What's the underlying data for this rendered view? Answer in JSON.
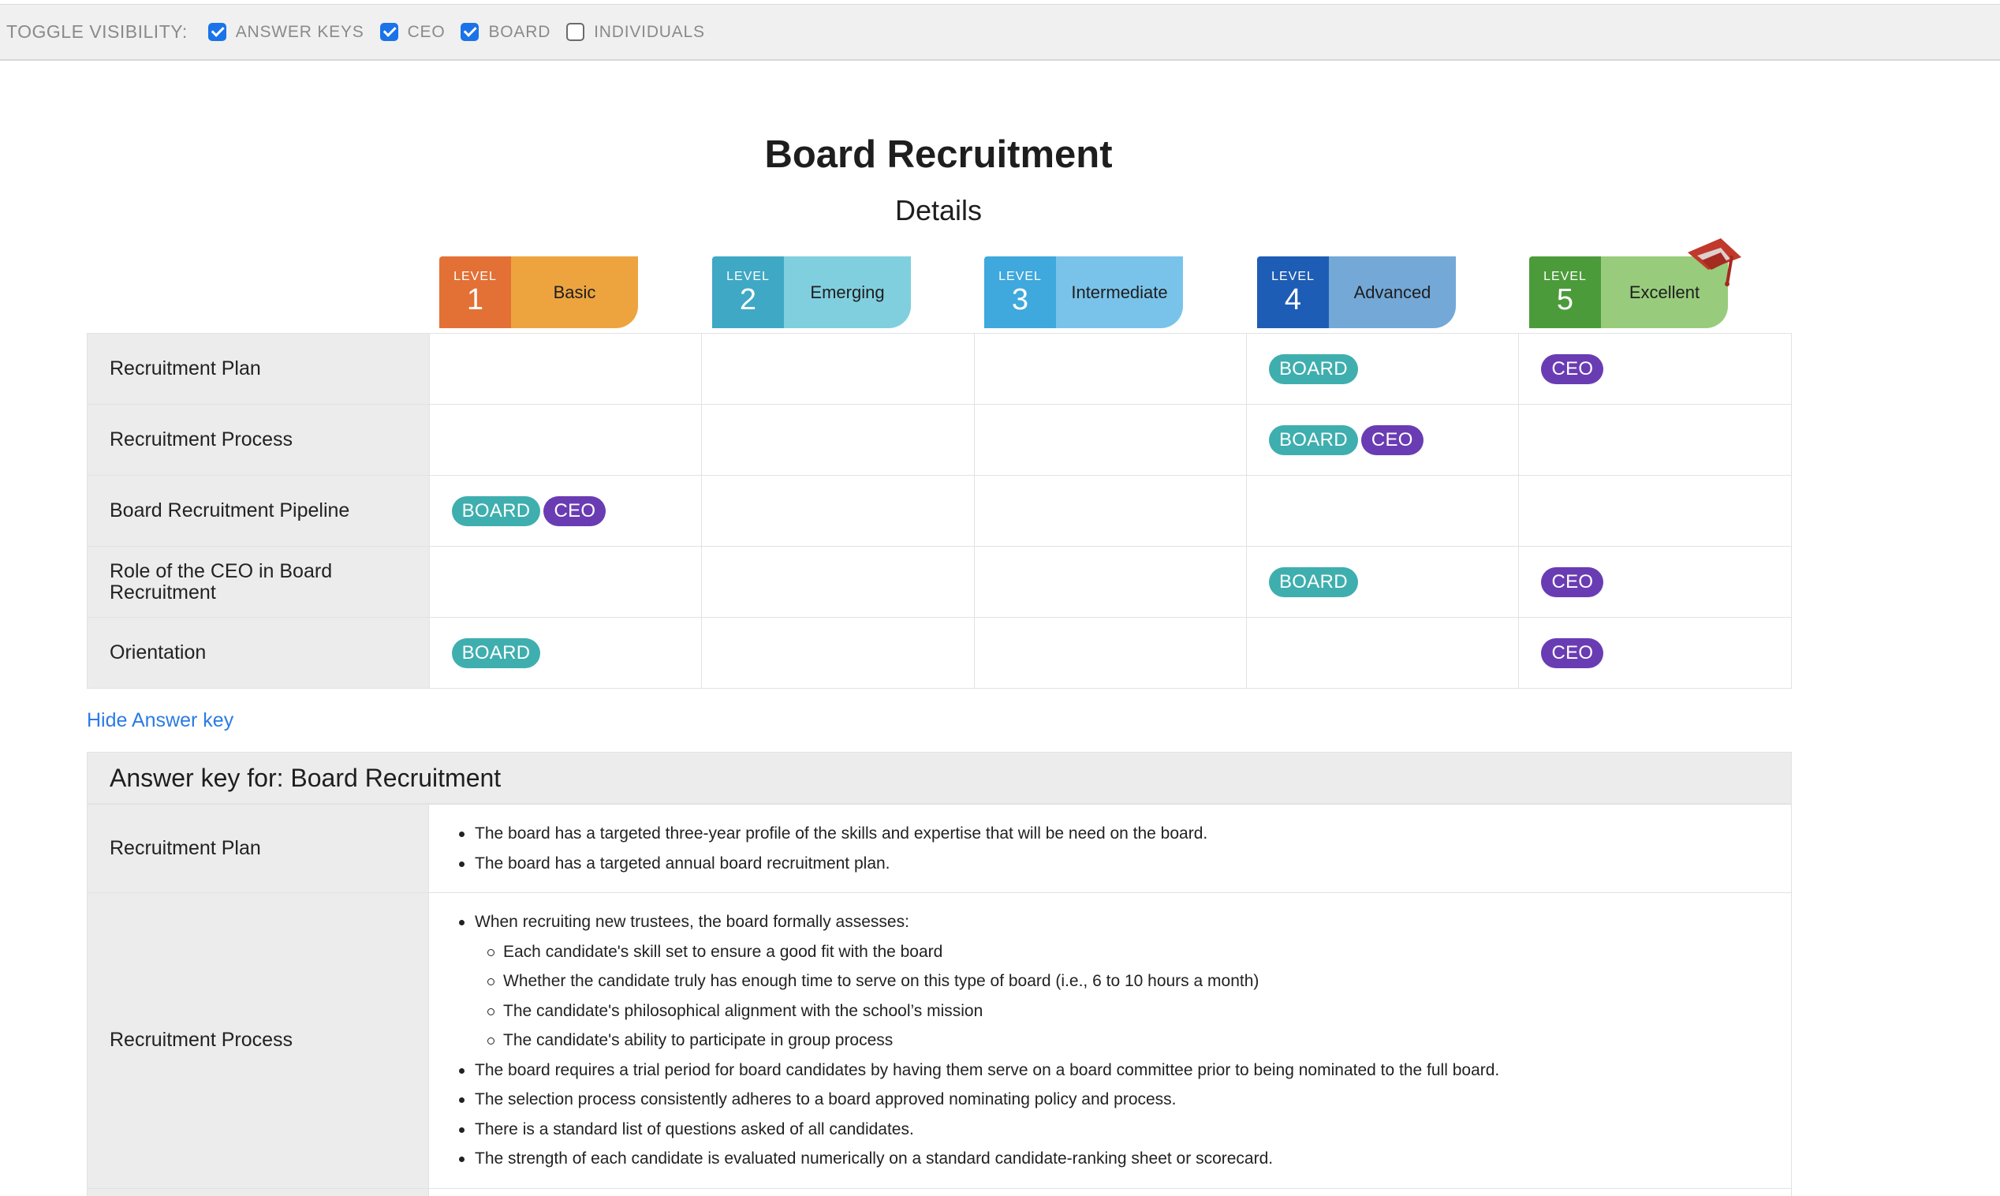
{
  "toggle_bar": {
    "label": "TOGGLE VISIBILITY:",
    "items": [
      {
        "label": "ANSWER KEYS",
        "checked": true
      },
      {
        "label": "CEO",
        "checked": true
      },
      {
        "label": "BOARD",
        "checked": true
      },
      {
        "label": "INDIVIDUALS",
        "checked": false
      }
    ]
  },
  "page": {
    "title": "Board Recruitment",
    "subtitle": "Details"
  },
  "levels": [
    {
      "prefix": "LEVEL",
      "number": "1",
      "name": "Basic",
      "num_color": "#e37034",
      "name_color": "#eda43f"
    },
    {
      "prefix": "LEVEL",
      "number": "2",
      "name": "Emerging",
      "num_color": "#3fa8c5",
      "name_color": "#80cfdf"
    },
    {
      "prefix": "LEVEL",
      "number": "3",
      "name": "Intermediate",
      "num_color": "#3fa8dc",
      "name_color": "#79c3ea"
    },
    {
      "prefix": "LEVEL",
      "number": "4",
      "name": "Advanced",
      "num_color": "#1e5db5",
      "name_color": "#73a8d7"
    },
    {
      "prefix": "LEVEL",
      "number": "5",
      "name": "Excellent",
      "num_color": "#4c9b3a",
      "name_color": "#98cc7c"
    }
  ],
  "tag_labels": {
    "board": "BOARD",
    "ceo": "CEO"
  },
  "tag_colors": {
    "board": "#3faeae",
    "ceo": "#6a3cb3"
  },
  "matrix_rows": [
    {
      "label": "Recruitment Plan",
      "board_level": 4,
      "ceo_level": 5
    },
    {
      "label": "Recruitment Process",
      "board_level": 4,
      "ceo_level": 4
    },
    {
      "label": "Board Recruitment Pipeline",
      "board_level": 1,
      "ceo_level": 1
    },
    {
      "label": "Role of the CEO in Board Recruitment",
      "board_level": 4,
      "ceo_level": 5
    },
    {
      "label": "Orientation",
      "board_level": 1,
      "ceo_level": 5
    }
  ],
  "hide_answer_link": "Hide Answer key",
  "answer_key": {
    "header": "Answer key for: Board Recruitment",
    "rows": [
      {
        "label": "Recruitment Plan",
        "items": [
          {
            "text": "The board has a targeted three-year profile of the skills and expertise that will be need on the board."
          },
          {
            "text": "The board has a targeted annual board recruitment plan."
          }
        ]
      },
      {
        "label": "Recruitment Process",
        "items": [
          {
            "text": "When recruiting new trustees, the board formally assesses:",
            "sub": [
              "Each candidate's skill set to ensure a good fit with the board",
              "Whether the candidate truly has enough time to serve on this type of board (i.e., 6 to 10 hours a month)",
              "The candidate's philosophical alignment with the school’s mission",
              "The candidate's ability to participate in group process"
            ]
          },
          {
            "text": "The board requires a trial period for board candidates by having them serve on a board committee prior to being nominated to the full board."
          },
          {
            "text": "The selection process consistently adheres to a board approved nominating policy and process."
          },
          {
            "text": "There is a standard list of questions asked of all candidates."
          },
          {
            "text": "The strength of each candidate is evaluated numerically on a standard candidate-ranking sheet or scorecard."
          }
        ]
      }
    ]
  }
}
